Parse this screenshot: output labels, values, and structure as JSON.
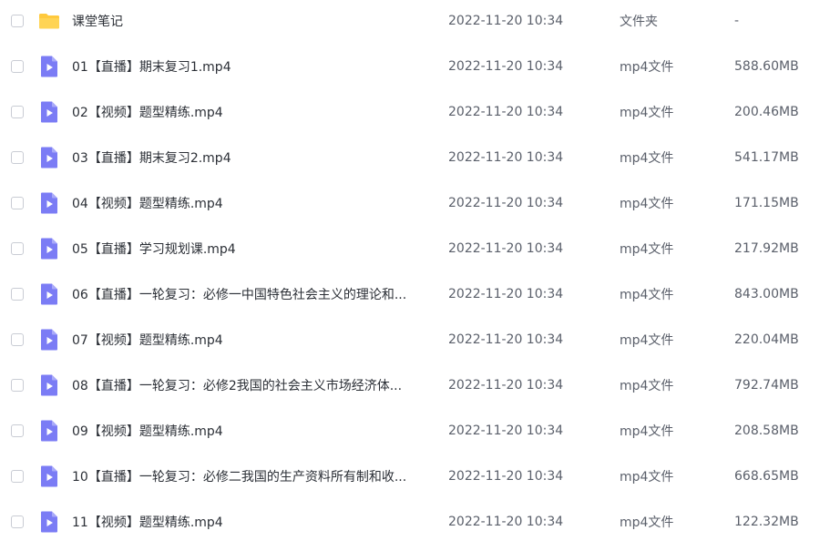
{
  "files": [
    {
      "icon": "folder-icon",
      "name": "课堂笔记",
      "date": "2022-11-20 10:34",
      "type": "文件夹",
      "size": "-"
    },
    {
      "icon": "video-file-icon",
      "name": "01【直播】期末复习1.mp4",
      "date": "2022-11-20 10:34",
      "type": "mp4文件",
      "size": "588.60MB"
    },
    {
      "icon": "video-file-icon",
      "name": "02【视频】题型精练.mp4",
      "date": "2022-11-20 10:34",
      "type": "mp4文件",
      "size": "200.46MB"
    },
    {
      "icon": "video-file-icon",
      "name": "03【直播】期末复习2.mp4",
      "date": "2022-11-20 10:34",
      "type": "mp4文件",
      "size": "541.17MB"
    },
    {
      "icon": "video-file-icon",
      "name": "04【视频】题型精练.mp4",
      "date": "2022-11-20 10:34",
      "type": "mp4文件",
      "size": "171.15MB"
    },
    {
      "icon": "video-file-icon",
      "name": "05【直播】学习规划课.mp4",
      "date": "2022-11-20 10:34",
      "type": "mp4文件",
      "size": "217.92MB"
    },
    {
      "icon": "video-file-icon",
      "name": "06【直播】一轮复习：必修一中国特色社会主义的理论和...",
      "date": "2022-11-20 10:34",
      "type": "mp4文件",
      "size": "843.00MB"
    },
    {
      "icon": "video-file-icon",
      "name": "07【视频】题型精练.mp4",
      "date": "2022-11-20 10:34",
      "type": "mp4文件",
      "size": "220.04MB"
    },
    {
      "icon": "video-file-icon",
      "name": "08【直播】一轮复习：必修2我国的社会主义市场经济体...",
      "date": "2022-11-20 10:34",
      "type": "mp4文件",
      "size": "792.74MB"
    },
    {
      "icon": "video-file-icon",
      "name": "09【视频】题型精练.mp4",
      "date": "2022-11-20 10:34",
      "type": "mp4文件",
      "size": "208.58MB"
    },
    {
      "icon": "video-file-icon",
      "name": "10【直播】一轮复习：必修二我国的生产资料所有制和收...",
      "date": "2022-11-20 10:34",
      "type": "mp4文件",
      "size": "668.65MB"
    },
    {
      "icon": "video-file-icon",
      "name": "11【视频】题型精练.mp4",
      "date": "2022-11-20 10:34",
      "type": "mp4文件",
      "size": "122.32MB"
    }
  ],
  "colors": {
    "folder": "#ffc93d",
    "video": "#7b7cf5"
  }
}
